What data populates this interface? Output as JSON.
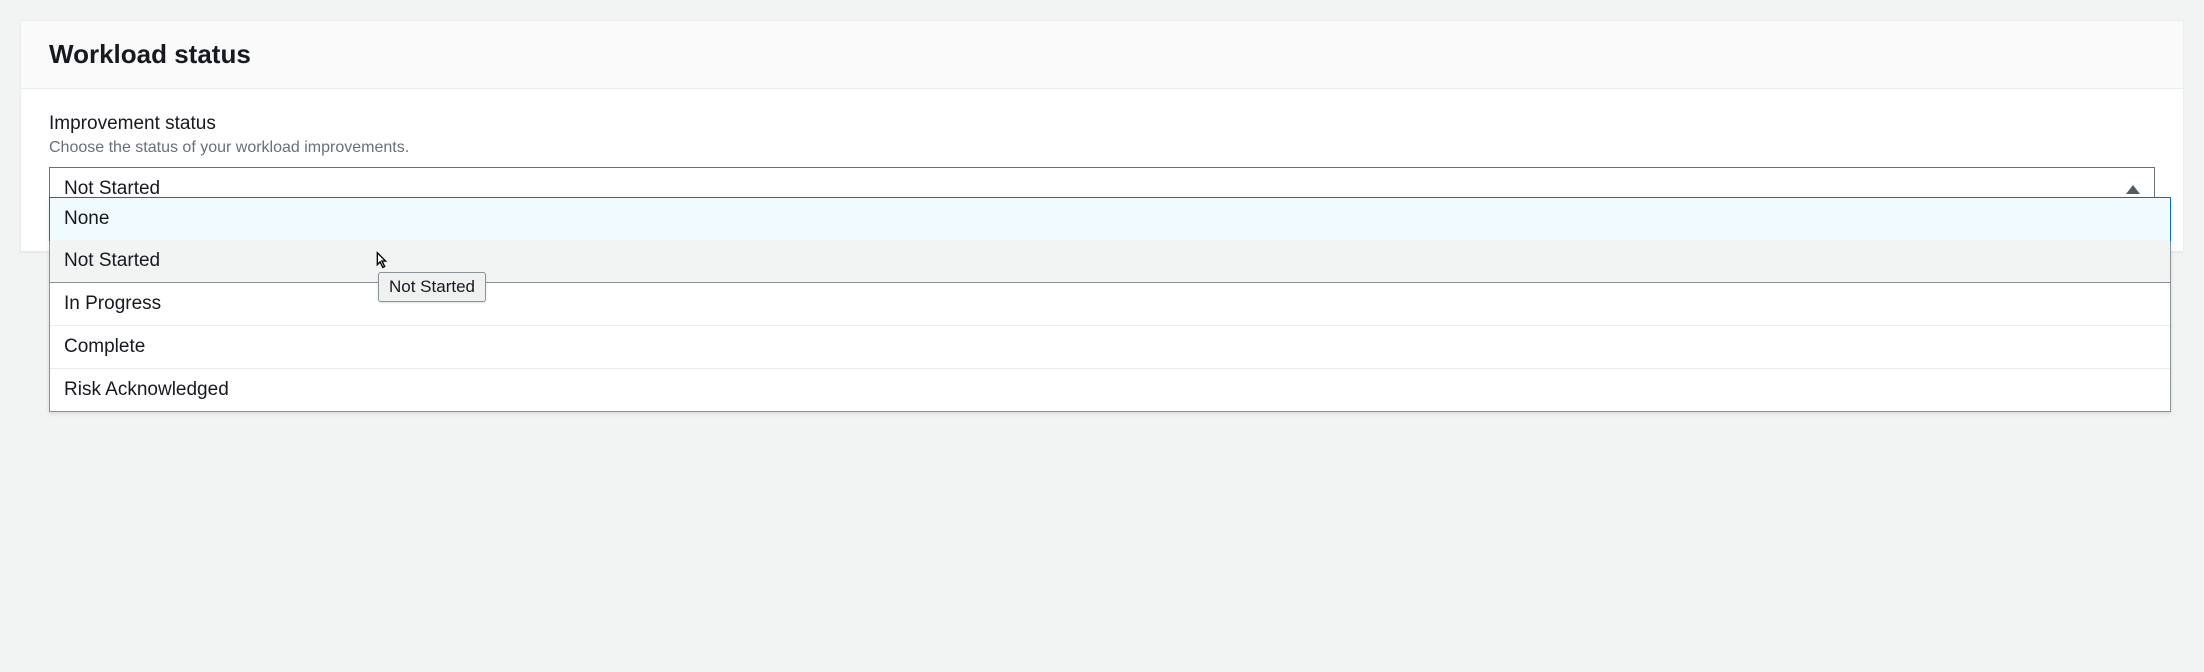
{
  "panel": {
    "title": "Workload status"
  },
  "field": {
    "label": "Improvement status",
    "hint": "Choose the status of your workload improvements.",
    "selected": "Not Started"
  },
  "options": [
    "None",
    "Not Started",
    "In Progress",
    "Complete",
    "Risk Acknowledged"
  ],
  "tooltip": "Not Started"
}
